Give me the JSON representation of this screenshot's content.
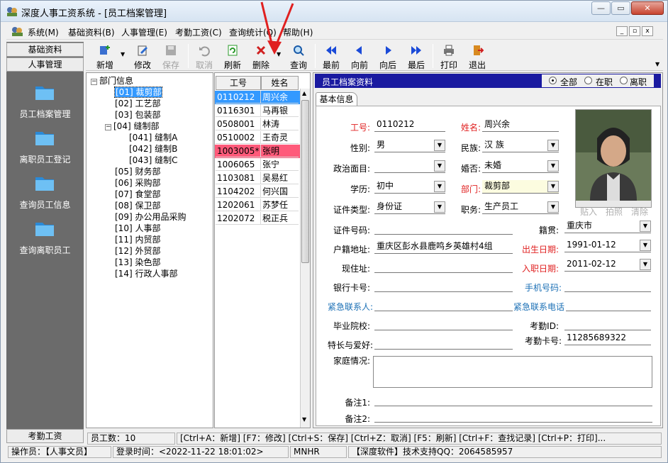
{
  "window": {
    "title": "深度人事工资系统 - [员工档案管理]"
  },
  "menu": {
    "items": [
      "系统(M)",
      "基础资料(B)",
      "人事管理(E)",
      "考勤工资(C)",
      "查询统计(Q)",
      "帮助(H)"
    ]
  },
  "leftpanel": {
    "tab1": "基础资料",
    "tab2": "人事管理",
    "items": [
      "员工档案管理",
      "离职员工登记",
      "查询员工信息",
      "查询离职员工"
    ],
    "bottom_tab": "考勤工资"
  },
  "toolbar": {
    "new": "新增",
    "edit": "修改",
    "save": "保存",
    "cancel": "取消",
    "refresh": "刷新",
    "delete": "删除",
    "query": "查询",
    "first": "最前",
    "prev": "向前",
    "next": "向后",
    "last": "最后",
    "print": "打印",
    "exit": "退出"
  },
  "tree": {
    "root": "部门信息",
    "nodes": [
      "[01] 裁剪部",
      "[02] 工艺部",
      "[03] 包装部",
      "[04] 缝制部",
      "[041] 缝制A",
      "[042] 缝制B",
      "[043] 缝制C",
      "[05] 财务部",
      "[06] 采购部",
      "[07] 食堂部",
      "[08] 保卫部",
      "[09] 办公用品采购",
      "[10] 人事部",
      "[11] 内贸部",
      "[12] 外贸部",
      "[13] 染色部",
      "[14] 行政人事部"
    ]
  },
  "grid": {
    "headers": [
      "工号",
      "姓名"
    ],
    "rows": [
      [
        "0110212",
        "周兴余"
      ],
      [
        "0116301",
        "马再银"
      ],
      [
        "0508001",
        "林涛"
      ],
      [
        "0510002",
        "王奇灵"
      ],
      [
        "1003005*",
        "张明"
      ],
      [
        "1006065",
        "张宁"
      ],
      [
        "1103081",
        "吴易红"
      ],
      [
        "1104202",
        "何兴国"
      ],
      [
        "1202061",
        "苏梦任"
      ],
      [
        "1202072",
        "税正兵"
      ]
    ]
  },
  "form": {
    "header": "员工档案资料",
    "filter": {
      "all": "全部",
      "active": "在职",
      "left": "离职"
    },
    "tab": "基本信息",
    "labels": {
      "id": "工号:",
      "name": "姓名:",
      "gender": "性别:",
      "ethnicity": "民族:",
      "politics": "政治面目:",
      "married": "婚否:",
      "education": "学历:",
      "dept": "部门:",
      "idtype": "证件类型:",
      "position": "职务:",
      "idno": "证件号码:",
      "origin": "籍贯:",
      "address": "户籍地址:",
      "birth": "出生日期:",
      "current": "现住址:",
      "hire": "入职日期:",
      "bank": "银行卡号:",
      "mobile": "手机号码:",
      "emerg": "紧急联系人:",
      "emerg_tel": "紧急联系电话",
      "school": "毕业院校:",
      "att_id": "考勤ID:",
      "hobby": "特长与爱好:",
      "att_card": "考勤卡号:",
      "family": "家庭情况:",
      "note1": "备注1:",
      "note2": "备注2:"
    },
    "values": {
      "id": "0110212",
      "name": "周兴余",
      "gender": "男",
      "ethnicity": "汉  族",
      "politics": "",
      "married": "未婚",
      "education": "初中",
      "dept": "裁剪部",
      "idtype": "身份证",
      "position": "生产员工",
      "idno": "",
      "origin": "重庆市",
      "address": "重庆区彭水县鹿鸣乡英雄村4组",
      "birth": "1991-01-12",
      "current": "",
      "hire": "2011-02-12",
      "bank": "",
      "mobile": "",
      "emerg": "",
      "emerg_tel": "",
      "school": "",
      "att_id": "",
      "hobby": "",
      "att_card": "11285689322",
      "note1": "",
      "note2": ""
    },
    "photo_buttons": [
      "贴入",
      "拍照",
      "清除"
    ]
  },
  "status1": [
    "员工数：10",
    "[Ctrl+A：新增]  [F7：修改]  [Ctrl+S：保存]  [Ctrl+Z：取消]  [F5：刷新]  [Ctrl+F：查找记录]  [Ctrl+P：打印]..."
  ],
  "status2": [
    "操作员：【人事文员】",
    "登录时间：<2022-11-22 18:01:02>",
    "MNHR",
    "【深度软件】技术支持QQ：2064585957"
  ],
  "colors": {
    "header_bg": "#1a1aa0",
    "selected_row": "#3399ff",
    "highlight_row": "#ff5a7a",
    "required_label": "#e02020",
    "contact_label": "#1a6fb5"
  }
}
